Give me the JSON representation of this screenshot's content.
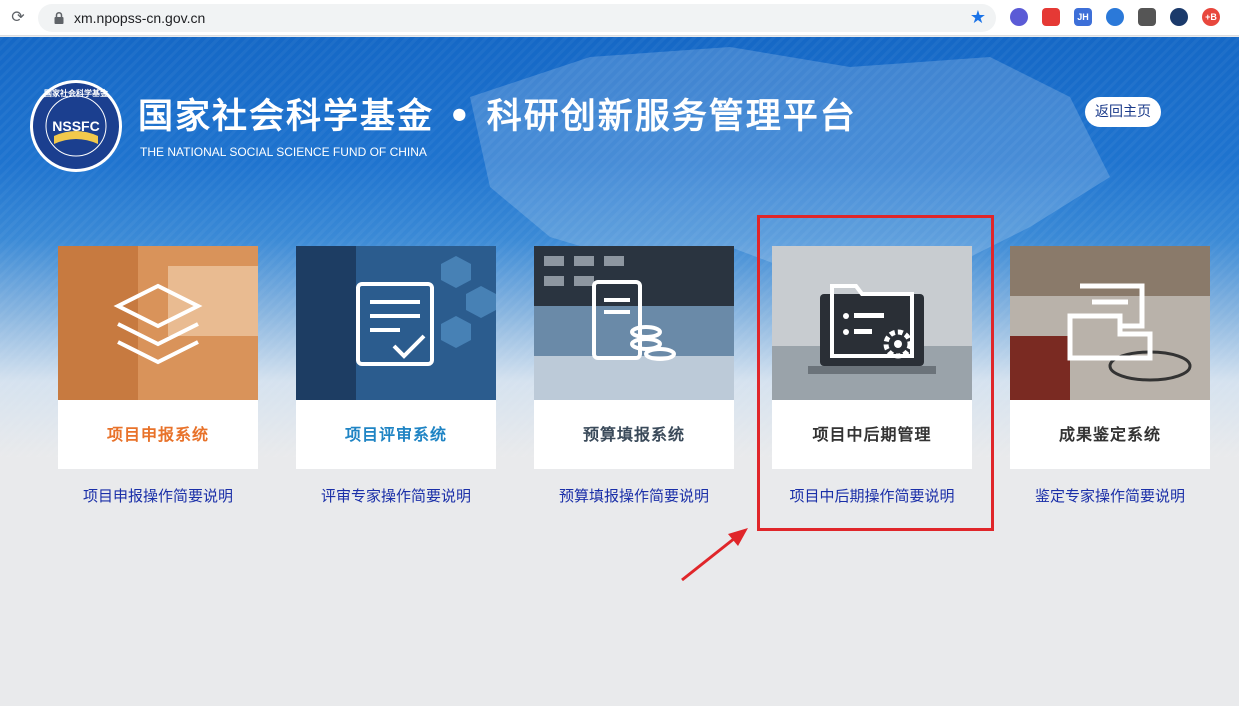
{
  "browser": {
    "url": "xm.npopss-cn.gov.cn",
    "extensions": [
      {
        "name": "check-extension-icon",
        "color": "#5b5bd6",
        "text": ""
      },
      {
        "name": "red-extension-icon",
        "color": "#e53935",
        "text": ""
      },
      {
        "name": "jh-extension-icon",
        "color": "#3d6fd8",
        "text": "JH"
      },
      {
        "name": "bird-extension-icon",
        "color": "#2b79d9",
        "text": ""
      },
      {
        "name": "parachute-extension-icon",
        "color": "#555555",
        "text": ""
      },
      {
        "name": "globe-extension-icon",
        "color": "#1b3a6b",
        "text": ""
      },
      {
        "name": "tb-extension-icon",
        "color": "#e8473d",
        "text": "+B"
      }
    ]
  },
  "header": {
    "logo_text": "NSSFC",
    "logo_ring_text": "国家社会科学基金",
    "title": "国家社会科学基金 • 科研创新服务管理平台",
    "subtitle": "THE NATIONAL SOCIAL SCIENCE FUND OF CHINA",
    "home_button": "返回主页"
  },
  "cards": [
    {
      "title": "项目申报系统",
      "title_color": "#e8722a",
      "link": "项目申报操作简要说明",
      "theme": "#d98a4a"
    },
    {
      "title": "项目评审系统",
      "title_color": "#1f84c4",
      "link": "评审专家操作简要说明",
      "theme": "#2a6aa0"
    },
    {
      "title": "预算填报系统",
      "title_color": "#3a4a5a",
      "link": "预算填报操作简要说明",
      "theme": "#5a7a9a"
    },
    {
      "title": "项目中后期管理",
      "title_color": "#333333",
      "link": "项目中后期操作简要说明",
      "theme": "#9aa6ae"
    },
    {
      "title": "成果鉴定系统",
      "title_color": "#333333",
      "link": "鉴定专家操作简要说明",
      "theme": "#7a6a5a"
    }
  ],
  "colors": {
    "annotation": "#e0262a",
    "link": "#1a2fa8"
  }
}
